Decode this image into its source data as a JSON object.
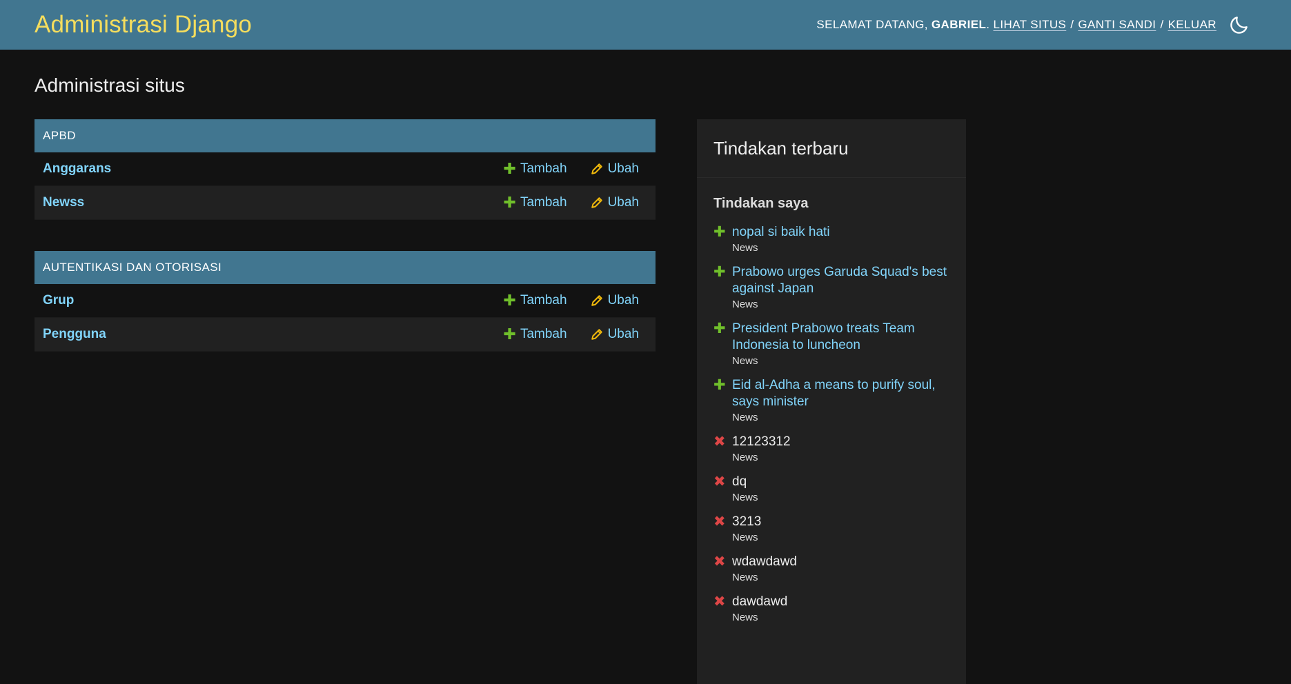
{
  "header": {
    "site_name": "Administrasi Django",
    "welcome": "Selamat datang,",
    "username": "Gabriel",
    "links": {
      "view_site": "Lihat situs",
      "change_password": "Ganti sandi",
      "logout": "Keluar"
    },
    "separator": "/",
    "theme_icon": "moon-icon"
  },
  "page": {
    "title": "Administrasi situs"
  },
  "apps": [
    {
      "name": "APBD",
      "models": [
        {
          "name": "Anggarans",
          "add": "Tambah",
          "change": "Ubah"
        },
        {
          "name": "Newss",
          "add": "Tambah",
          "change": "Ubah"
        }
      ]
    },
    {
      "name": "Autentikasi dan Otorisasi",
      "models": [
        {
          "name": "Grup",
          "add": "Tambah",
          "change": "Ubah"
        },
        {
          "name": "Pengguna",
          "add": "Tambah",
          "change": "Ubah"
        }
      ]
    }
  ],
  "recent": {
    "title": "Tindakan terbaru",
    "subtitle": "Tindakan saya",
    "actions": [
      {
        "kind": "add",
        "title": "nopal si baik hati",
        "type": "News"
      },
      {
        "kind": "add",
        "title": "Prabowo urges Garuda Squad's best against Japan",
        "type": "News"
      },
      {
        "kind": "add",
        "title": "President Prabowo treats Team Indonesia to luncheon",
        "type": "News"
      },
      {
        "kind": "add",
        "title": "Eid al-Adha a means to purify soul, says minister",
        "type": "News"
      },
      {
        "kind": "delete",
        "title": "12123312",
        "type": "News"
      },
      {
        "kind": "delete",
        "title": "dq",
        "type": "News"
      },
      {
        "kind": "delete",
        "title": "3213",
        "type": "News"
      },
      {
        "kind": "delete",
        "title": "wdawdawd",
        "type": "News"
      },
      {
        "kind": "delete",
        "title": "dawdawd",
        "type": "News"
      }
    ]
  },
  "colors": {
    "header_bg": "#417690",
    "branding": "#f5dd5d",
    "link": "#81d4fa",
    "add_green": "#70bf2b",
    "delete_red": "#dd4646",
    "change_yellow": "#efb80b",
    "page_bg": "#121212"
  }
}
